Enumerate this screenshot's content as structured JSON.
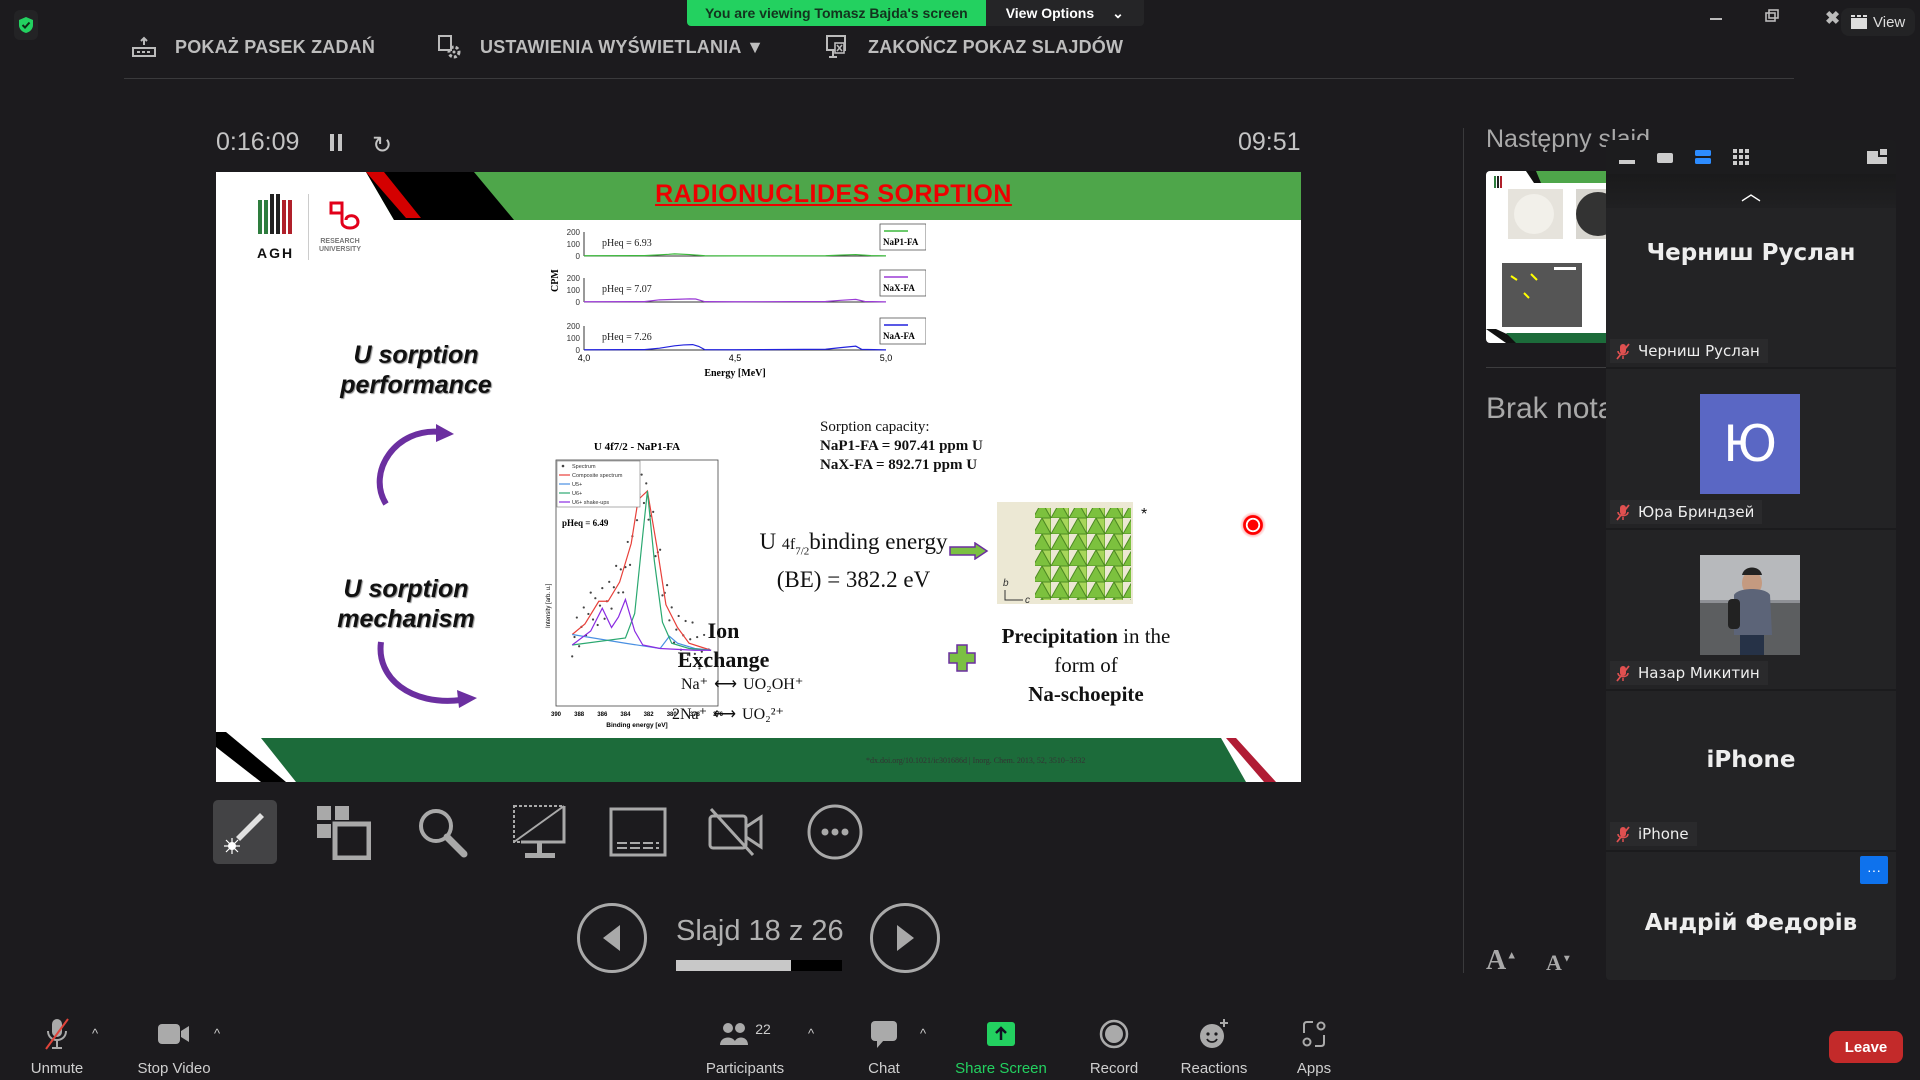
{
  "top_toolbar": {
    "show_taskbar": "POKAŻ PASEK ZADAŃ",
    "display_settings": "USTAWIENIA WYŚWIETLANIA ▼",
    "end_slideshow": "ZAKOŃCZ POKAZ SLAJDÓW"
  },
  "share_banner": {
    "viewing_text": "You are viewing Tomasz Bajda's screen",
    "view_options": "View Options"
  },
  "window": {
    "view_label": "View"
  },
  "presenter": {
    "elapsed_time": "0:16:09",
    "clock": "09:51",
    "next_slide_label": "Następny slajd",
    "notes_text": "Brak notatek",
    "slide_counter": "Slajd 18 z 26",
    "current_slide": 18,
    "total_slides": 26,
    "progress_fraction": 0.69
  },
  "slide": {
    "title": "RADIONUCLIDES  SORPTION",
    "logo_agh": "AGH",
    "logo_research": "RESEARCH",
    "logo_university": "UNIVERSITY",
    "label_performance_1": "U sorption",
    "label_performance_2": "performance",
    "label_mechanism_1": "U sorption",
    "label_mechanism_2": "mechanism",
    "sorption_capacity_title": "Sorption capacity:",
    "sorption_napl": "NaP1-FA = 907.41 ppm U",
    "sorption_nax": "NaX-FA = 892.71 ppm U",
    "binding_energy_1a": "U ",
    "binding_energy_1b": "4f",
    "binding_energy_1c": "7/2",
    "binding_energy_1d": "binding energy",
    "binding_energy_2": "(BE) = 382.2 eV",
    "ion_exchange_1": "Ion",
    "ion_exchange_2": "Exchange",
    "eq1_left": "Na⁺",
    "eq1_right": "UO₂OH⁺",
    "eq2_left": "2Na⁺",
    "eq2_right": "UO₂²⁺",
    "precip_bold": "Precipitation",
    "precip_rest": " in the",
    "precip_2": "form of",
    "precip_3": "Na-schoepite",
    "asterisk": "*",
    "axis_b": "b",
    "axis_c": "c",
    "citation": "*dx.doi.org/10.1021/ic301686d | Inorg. Chem. 2013, 52, 3510−3532"
  },
  "chart_data": [
    {
      "type": "line",
      "title": "",
      "xlabel": "Energy [MeV]",
      "ylabel": "CPM",
      "xlim": [
        4.0,
        5.0
      ],
      "x_ticks": [
        "4,0",
        "4,5",
        "5,0"
      ],
      "y_ticks": [
        "0",
        "100",
        "200"
      ],
      "ylim": [
        0,
        200
      ],
      "panels": [
        {
          "name": "NaP1-FA",
          "annotation": "pHeq = 6.93",
          "color": "#3cb83c",
          "x": [
            4.0,
            4.2,
            4.25,
            4.28,
            4.3,
            4.35,
            4.4,
            4.5,
            4.8,
            4.85,
            4.9,
            4.95,
            5.0
          ],
          "y": [
            2,
            3,
            10,
            14,
            18,
            12,
            2,
            1,
            2,
            8,
            12,
            3,
            1
          ]
        },
        {
          "name": "NaX-FA",
          "annotation": "pHeq = 7.07",
          "color": "#9b3bd6",
          "x": [
            4.0,
            4.2,
            4.25,
            4.3,
            4.35,
            4.37,
            4.4,
            4.5,
            4.8,
            4.85,
            4.9,
            4.93,
            5.0
          ],
          "y": [
            2,
            3,
            18,
            22,
            26,
            25,
            3,
            2,
            4,
            14,
            22,
            4,
            1
          ]
        },
        {
          "name": "NaA-FA",
          "annotation": "pHeq = 7.26",
          "color": "#2222dd",
          "x": [
            4.0,
            4.2,
            4.25,
            4.3,
            4.33,
            4.36,
            4.38,
            4.4,
            4.5,
            4.8,
            4.85,
            4.9,
            4.92,
            5.0
          ],
          "y": [
            2,
            3,
            15,
            35,
            42,
            45,
            30,
            3,
            2,
            6,
            20,
            32,
            5,
            1
          ]
        }
      ]
    },
    {
      "type": "line",
      "title": "U 4f7/2 - NaP1-FA",
      "xlabel": "Binding energy [eV]",
      "ylabel": "Intensity [arb. u.]",
      "xlim": [
        390,
        376
      ],
      "x_ticks": [
        "390",
        "388",
        "386",
        "384",
        "382",
        "380",
        "378",
        "376"
      ],
      "annotation": "pHeq = 6.49",
      "legend": [
        "Spectrum",
        "Composite spectrum",
        "U5+",
        "U6+",
        "U6+ shake-ups"
      ],
      "legend_position": "top-left",
      "series": [
        {
          "name": "Composite spectrum",
          "color": "#e8403a",
          "x": [
            388.6,
            387.5,
            386.3,
            385.5,
            384.5,
            383.5,
            382.9,
            382.1,
            381.2,
            380.5,
            379.5,
            378.5,
            376.6
          ],
          "y": [
            0.18,
            0.24,
            0.37,
            0.37,
            0.48,
            0.7,
            0.95,
            1.0,
            0.65,
            0.35,
            0.22,
            0.13,
            0.09
          ]
        },
        {
          "name": "U5+",
          "color": "#4a90e2",
          "x": [
            388.6,
            384,
            381,
            380.2,
            379.5,
            378,
            376.6
          ],
          "y": [
            0.18,
            0.13,
            0.1,
            0.17,
            0.13,
            0.1,
            0.09
          ]
        },
        {
          "name": "U6+",
          "color": "#2aa870",
          "x": [
            388.6,
            384,
            383.2,
            382.5,
            382.1,
            381.5,
            380.8,
            380,
            378.5,
            376.6
          ],
          "y": [
            0.12,
            0.16,
            0.3,
            0.75,
            1.0,
            0.6,
            0.25,
            0.13,
            0.1,
            0.09
          ]
        },
        {
          "name": "U6+ shake-ups",
          "color": "#8a2be2",
          "x": [
            388.6,
            387,
            386,
            385.2,
            384.6,
            384,
            383.2,
            382.5,
            381,
            378,
            376.6
          ],
          "y": [
            0.12,
            0.2,
            0.33,
            0.22,
            0.28,
            0.38,
            0.2,
            0.12,
            0.1,
            0.09,
            0.09
          ]
        }
      ]
    }
  ],
  "presenter_tools": [
    {
      "name": "laser-pointer-tool",
      "active": true
    },
    {
      "name": "see-all-slides-tool"
    },
    {
      "name": "zoom-slide-tool"
    },
    {
      "name": "black-screen-tool"
    },
    {
      "name": "subtitles-tool"
    },
    {
      "name": "camera-off-tool"
    },
    {
      "name": "more-options-tool"
    }
  ],
  "gallery": {
    "tiles": [
      {
        "big_name": "Черниш Руслан",
        "tag": "Черниш Руслан",
        "muted": true
      },
      {
        "avatar_letter": "Ю",
        "avatar_color": "#5a67c4",
        "tag": "Юра Бриндзей",
        "muted": true
      },
      {
        "photo": true,
        "tag": "Назар Микитин",
        "muted": true
      },
      {
        "big_name": "iPhone",
        "tag": "iPhone",
        "muted": true
      },
      {
        "big_name": "Андрій Федорів",
        "tag": "Андрій Федорів",
        "muted": true,
        "more_button": "···"
      }
    ]
  },
  "bottom_bar": {
    "unmute": "Unmute",
    "stop_video": "Stop Video",
    "participants": "Participants",
    "participants_count": "22",
    "chat": "Chat",
    "share_screen": "Share Screen",
    "record": "Record",
    "reactions": "Reactions",
    "apps": "Apps",
    "leave": "Leave"
  },
  "colors": {
    "share_green": "#23d160",
    "leave_red": "#c32a2a",
    "slide_green": "#4ea64a",
    "slide_dark_green": "#1c6b3a",
    "slide_title_red": "#e00000",
    "active_view_blue": "#2d8cff"
  }
}
